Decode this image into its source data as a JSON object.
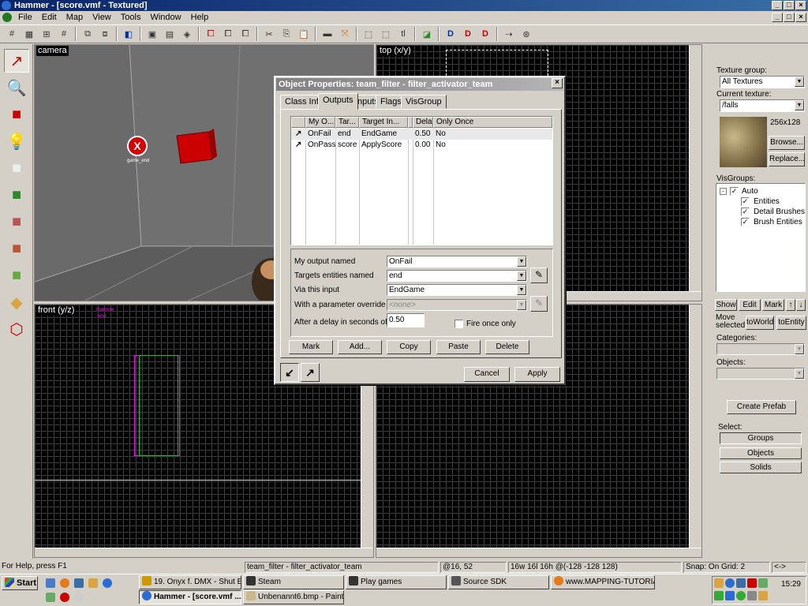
{
  "window": {
    "title": "Hammer - [score.vmf - Textured]"
  },
  "menu": [
    "File",
    "Edit",
    "Map",
    "View",
    "Tools",
    "Window",
    "Help"
  ],
  "viewports": {
    "camera": "camera",
    "top": "top (x/y)",
    "front": "front (y/z)",
    "entity_label": "game_end",
    "front_names": [
      "Hammer",
      "end"
    ]
  },
  "dialog": {
    "title": "Object Properties: team_filter - filter_activator_team",
    "tabs": [
      "Class Info",
      "Outputs",
      "Inputs",
      "Flags",
      "VisGroup"
    ],
    "columns": [
      "My O...",
      "Tar...",
      "Target In...",
      "Delay",
      "Only Once"
    ],
    "rows": [
      {
        "output": "OnFail",
        "target": "end",
        "input": "EndGame",
        "delay": "0.50",
        "once": "No"
      },
      {
        "output": "OnPass",
        "target": "score",
        "input": "ApplyScore",
        "delay": "0.00",
        "once": "No"
      }
    ],
    "labels": {
      "output": "My output named",
      "targets": "Targets entities named",
      "via": "Via this input",
      "param": "With a parameter override of",
      "delay": "After a delay in seconds of",
      "fire_once": "Fire once only"
    },
    "values": {
      "output": "OnFail",
      "targets": "end",
      "via": "EndGame",
      "param": "<none>",
      "delay": "0.50"
    },
    "buttons": {
      "mark": "Mark",
      "add": "Add...",
      "copy": "Copy",
      "paste": "Paste",
      "delete": "Delete",
      "cancel": "Cancel",
      "apply": "Apply"
    }
  },
  "right": {
    "texture_group_label": "Texture group:",
    "texture_group": "All Textures",
    "current_texture_label": "Current texture:",
    "current_texture": "/falls",
    "texture_size": "256x128",
    "browse": "Browse...",
    "replace": "Replace...",
    "visgroups_label": "VisGroups:",
    "visgroups": {
      "root": "Auto",
      "children": [
        "Entities",
        "Detail Brushes",
        "Brush Entities"
      ]
    },
    "show": "Show",
    "edit": "Edit",
    "mark": "Mark",
    "move_selected": "Move selected:",
    "to_world": "toWorld",
    "to_entity": "toEntity",
    "categories_label": "Categories:",
    "objects_label": "Objects:",
    "create_prefab": "Create Prefab",
    "select_label": "Select:",
    "select_groups": "Groups",
    "select_objects": "Objects",
    "select_solids": "Solids"
  },
  "status": {
    "help": "For Help, press F1",
    "selection": "team_filter - filter_activator_team",
    "coords": "@16, 52",
    "size": "16w 16l 16h @(-128 -128 128)",
    "snap": "Snap: On Grid: 2",
    "nav": "<->"
  },
  "taskbar": {
    "start": "Start",
    "tasks": [
      "19. Onyx f. DMX - Shut E...",
      "Steam",
      "Play games",
      "Source SDK",
      "www.MAPPING-TUTORIA...",
      "Hammer - [score.vmf ...",
      "Unbenannt6.bmp - Paint"
    ],
    "clock": "15:29"
  },
  "colors": {
    "accent": "#0a246a",
    "selection_magenta": "#ff00ff",
    "entity_red": "#cc0000"
  }
}
